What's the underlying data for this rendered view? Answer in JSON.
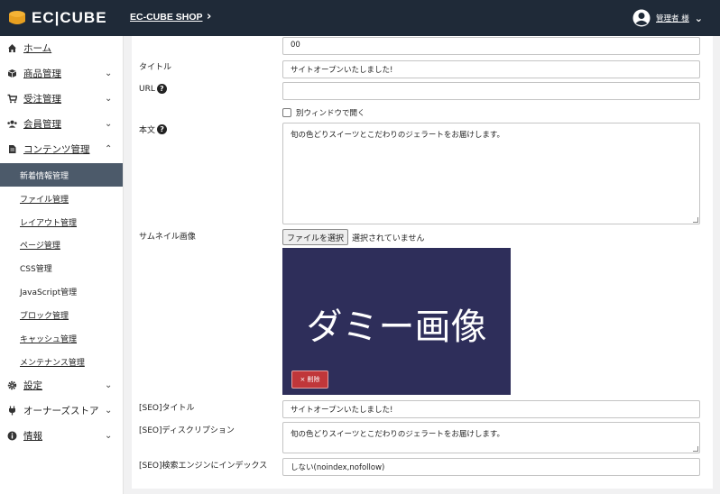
{
  "header": {
    "logo_text": "EC|CUBE",
    "shop_name": "EC-CUBE SHOP",
    "user_name": "管理者 様"
  },
  "sidebar": {
    "items": [
      {
        "label": "ホーム",
        "icon": "home-icon"
      },
      {
        "label": "商品管理",
        "icon": "cube-icon"
      },
      {
        "label": "受注管理",
        "icon": "cart-icon"
      },
      {
        "label": "会員管理",
        "icon": "users-icon"
      },
      {
        "label": "コンテンツ管理",
        "icon": "file-icon"
      },
      {
        "label": "設定",
        "icon": "gear-icon"
      },
      {
        "label": "オーナーズストア",
        "icon": "plug-icon"
      },
      {
        "label": "情報",
        "icon": "info-icon"
      }
    ],
    "sub_items": [
      {
        "label": "新着情報管理"
      },
      {
        "label": "ファイル管理"
      },
      {
        "label": "レイアウト管理"
      },
      {
        "label": "ページ管理"
      },
      {
        "label": "CSS管理"
      },
      {
        "label": "JavaScript管理"
      },
      {
        "label": "ブロック管理"
      },
      {
        "label": "キャッシュ管理"
      },
      {
        "label": "メンテナンス管理"
      }
    ]
  },
  "form": {
    "top_value": "00",
    "title_label": "タイトル",
    "title_value": "サイトオープンいたしました!",
    "url_label": "URL",
    "url_value": "",
    "new_window_label": "別ウィンドウで開く",
    "body_label": "本文",
    "body_value": "旬の色どりスイーツとこだわりのジェラートをお届けします。",
    "thumb_label": "サムネイル画像",
    "file_button": "ファイルを選択",
    "file_status": "選択されていません",
    "thumb_text": "ダミー画像",
    "delete_button": "× 削除",
    "seo_title_label": "[SEO]タイトル",
    "seo_title_value": "サイトオープンいたしました!",
    "seo_desc_label": "[SEO]ディスクリプション",
    "seo_desc_value": "旬の色どりスイーツとこだわりのジェラートをお届けします。",
    "seo_index_label": "[SEO]検索エンジンにインデックス",
    "seo_index_value": "しない(noindex,nofollow)"
  }
}
